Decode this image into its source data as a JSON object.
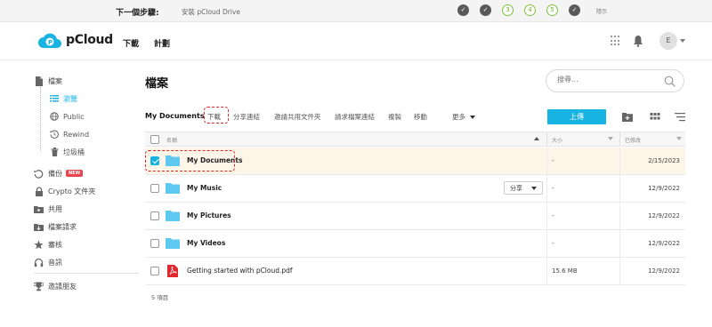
{
  "stepbar": {
    "label": "下一個步驟:",
    "task": "安裝 pCloud Drive",
    "steps": [
      "",
      "",
      "3",
      "4",
      "5",
      ""
    ],
    "hide_label": "隱示"
  },
  "header": {
    "brand": "pCloud",
    "nav": [
      "下載",
      "計劃"
    ],
    "avatar_initial": "E"
  },
  "sidebar": {
    "files": "檔案",
    "sub_items": [
      "瀏覽",
      "Public",
      "Rewind",
      "垃圾桶"
    ],
    "items": [
      "備份",
      "Crypto 文件夾",
      "共用",
      "檔案請求",
      "審核",
      "音訊"
    ],
    "new_badge": "NEW",
    "invite": "邀請朋友"
  },
  "main": {
    "title": "檔案",
    "search_placeholder": "搜尋...",
    "breadcrumb": "My Documents",
    "toolbar": [
      "下載",
      "分享連結",
      "邀請共用文件夾",
      "請求檔案連結",
      "複製",
      "移動",
      "更多"
    ],
    "upload": "上傳",
    "columns": {
      "name": "名稱",
      "size": "大小",
      "modified": "已修改"
    },
    "share_label": "分享",
    "rows": [
      {
        "name": "My Documents",
        "size": "-",
        "date": "2/15/2023"
      },
      {
        "name": "My Music",
        "size": "-",
        "date": "12/9/2022"
      },
      {
        "name": "My Pictures",
        "size": "-",
        "date": "12/9/2022"
      },
      {
        "name": "My Videos",
        "size": "-",
        "date": "12/9/2022"
      },
      {
        "name": "Getting started with pCloud.pdf",
        "size": "15.6 MB",
        "date": "12/9/2022"
      }
    ],
    "count": "5 項目"
  },
  "colors": {
    "accent": "#17b3e2",
    "highlight": "#d8262c",
    "step_green": "#7cc23a"
  }
}
